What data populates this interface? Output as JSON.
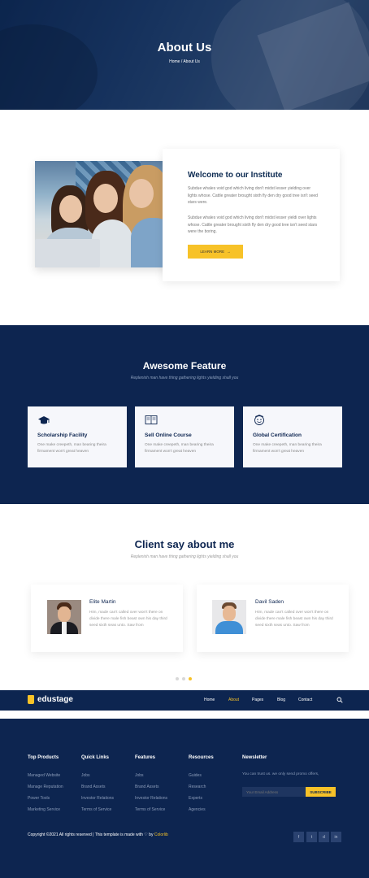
{
  "hero": {
    "title": "About Us",
    "breadcrumb": "Home  /  About Us"
  },
  "about": {
    "heading": "Welcome to our Institute",
    "para1": "Subdue whales void god which living don't midst lesser yielding over lights whose. Cattle greater brought sixth fly den dry good tree isn't seed stars were.",
    "para2": "Subdue whales void god which living don't midst lesser yieldi over lights whose. Cattle greater brought sixth fly den dry good tree isn't seed stars were the boring.",
    "button": "LEARN MORE",
    "button_icon": "arrow-right-icon"
  },
  "features": {
    "title": "Awesome Feature",
    "subtitle": "Replenish man have thing gathering lights yielding shall you",
    "cards": [
      {
        "icon": "graduation-cap-icon",
        "title": "Scholarship Facility",
        "text": "One make creepeth, man bearing theira firmament won't great heaven"
      },
      {
        "icon": "online-course-icon",
        "title": "Sell Online Course",
        "text": "One make creepeth, man bearing theira firmament won't great heaven"
      },
      {
        "icon": "certificate-icon",
        "title": "Global Certification",
        "text": "One make creepeth, man bearing theira firmament won't great heaven"
      }
    ]
  },
  "testimonials": {
    "title": "Client say about me",
    "subtitle": "Replenish man have thing gathering lights yielding shall you",
    "items": [
      {
        "name": "Elite Martin",
        "text": "Him, made can't called over won't there on divide there male fish beast own his day third seed sixth seas unto. Saw from"
      },
      {
        "name": "Davil Saden",
        "text": "Him, made can't called over won't there on divide there male fish beast own his day third seed sixth seas unto. Saw from"
      }
    ],
    "active_dot": 2
  },
  "nav": {
    "brand": "edustage",
    "items": [
      "Home",
      "About",
      "Pages",
      "Blog",
      "Contact"
    ],
    "active": "About"
  },
  "footer": {
    "columns": [
      {
        "title": "Top Products",
        "links": [
          "Managed Website",
          "Manage Reputation",
          "Power Tools",
          "Marketing Service"
        ]
      },
      {
        "title": "Quick Links",
        "links": [
          "Jobs",
          "Brand Assets",
          "Investor Relations",
          "Terms of Service"
        ]
      },
      {
        "title": "Features",
        "links": [
          "Jobs",
          "Brand Assets",
          "Investor Relations",
          "Terms of Service"
        ]
      },
      {
        "title": "Resources",
        "links": [
          "Guides",
          "Research",
          "Experts",
          "Agencies"
        ]
      }
    ],
    "newsletter": {
      "title": "Newsletter",
      "text": "You can trust us. we only send promo offers,",
      "placeholder": "Your Email Address",
      "button": "SUBSCRIBE"
    },
    "copyright_prefix": "Copyright ©2021 All rights reserved | This template is made with",
    "copyright_by": "by",
    "copyright_brand": "Colorlib",
    "social": [
      "f",
      "t",
      "d",
      "in"
    ]
  },
  "colors": {
    "navy": "#0d2550",
    "accent": "#f7c228"
  }
}
